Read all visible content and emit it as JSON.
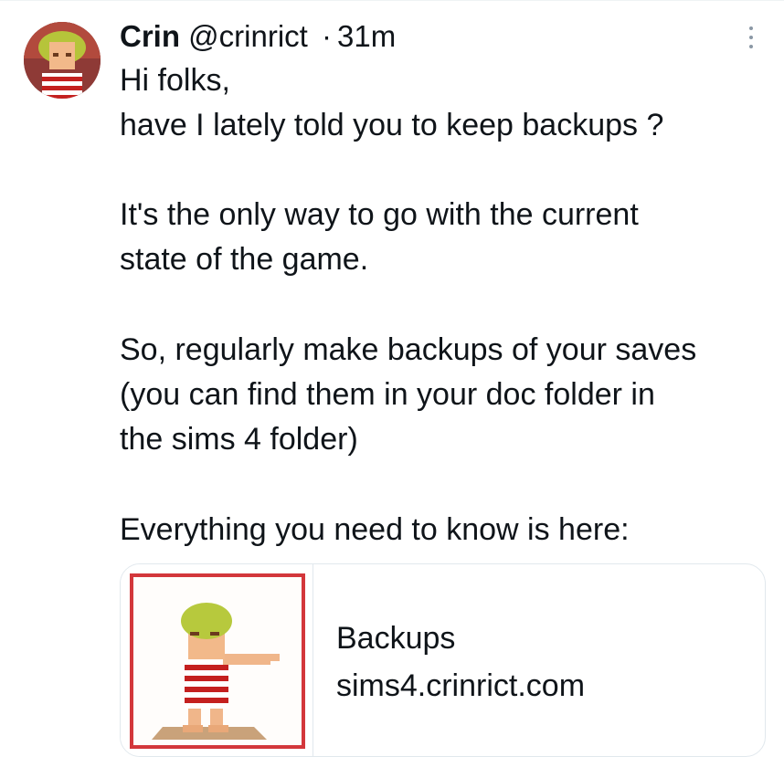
{
  "tweet": {
    "author_name": "Crin",
    "handle": "@crinrict",
    "separator": "·",
    "time": "31m",
    "avatar_icon": "pixel-character-avatar-icon",
    "more_icon": "more-options-icon",
    "lines": [
      "Hi folks,",
      "have I lately told you to keep backups ?",
      "It's the only way to go with the current",
      "state of the game.",
      "So, regularly make backups of your saves",
      "(you can find them in your doc folder in",
      "the sims 4 folder)",
      "Everything you need to know is here:"
    ]
  },
  "link_card": {
    "title": "Backups",
    "domain": "sims4.crinrict.com",
    "thumbnail_icon": "pixel-character-thumbnail",
    "thumbnail_border_color": "#d3373b"
  }
}
